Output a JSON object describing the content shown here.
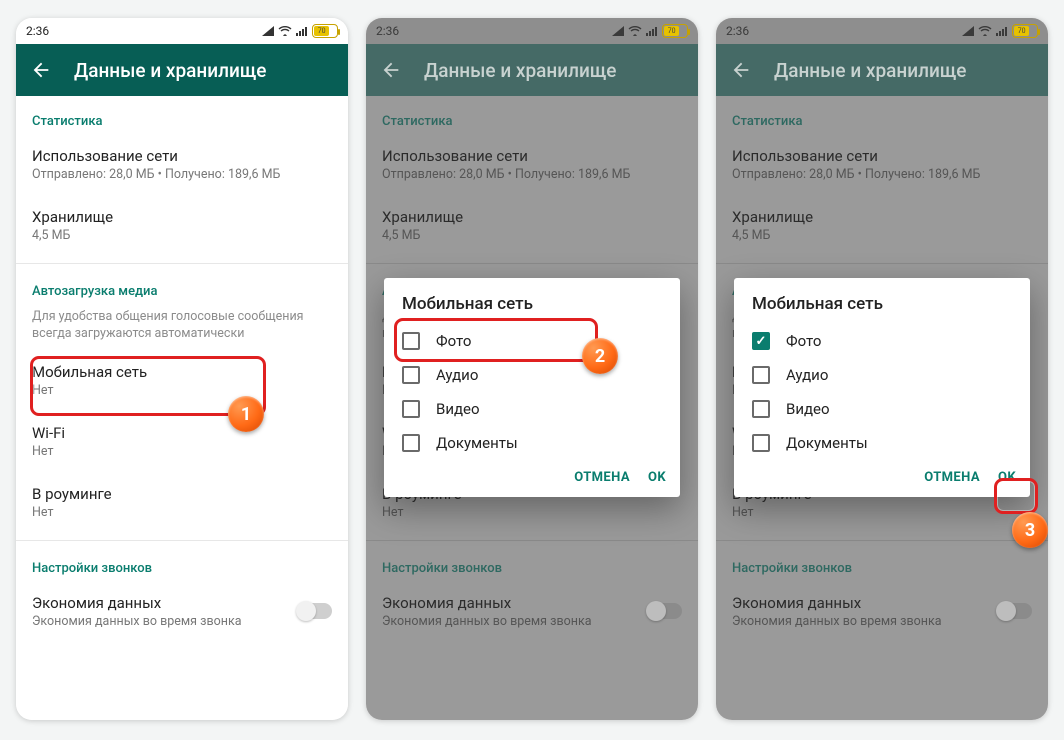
{
  "status": {
    "time": "2:36",
    "battery": "70"
  },
  "appbar": {
    "title": "Данные и хранилище"
  },
  "sections": {
    "stats": {
      "header": "Статистика"
    },
    "net_usage": {
      "title": "Использование сети",
      "sub": "Отправлено: 28,0 МБ • Получено: 189,6 МБ"
    },
    "storage": {
      "title": "Хранилище",
      "sub": "4,5 МБ"
    },
    "autodl": {
      "header": "Автозагрузка медиа",
      "hint": "Для удобства общения голосовые сообщения всегда загружаются автоматически"
    },
    "mobile": {
      "title": "Мобильная сеть",
      "sub": "Нет"
    },
    "wifi": {
      "title": "Wi-Fi",
      "sub": "Нет"
    },
    "roaming": {
      "title": "В роуминге",
      "sub": "Нет"
    },
    "calls": {
      "header": "Настройки звонков"
    },
    "datasaver": {
      "title": "Экономия данных",
      "sub": "Экономия данных во время звонка"
    }
  },
  "dialog": {
    "title": "Мобильная сеть",
    "items": {
      "photo": "Фото",
      "audio": "Аудио",
      "video": "Видео",
      "docs": "Документы"
    },
    "cancel": "ОТМЕНА",
    "ok": "OK"
  },
  "badges": {
    "b1": "1",
    "b2": "2",
    "b3": "3"
  }
}
